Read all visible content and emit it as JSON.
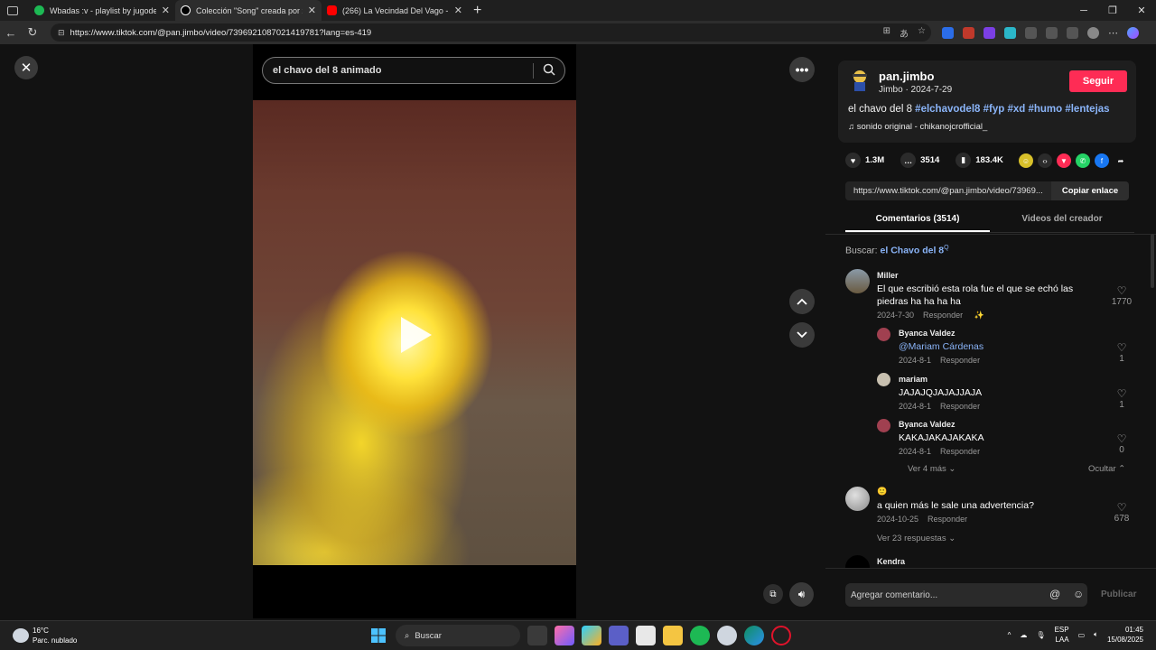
{
  "browser": {
    "tabs": [
      {
        "title": "Wbadas :v - playlist by jugodeuv",
        "color": "#1db954"
      },
      {
        "title": "Colección \"Song\" creada por xjun",
        "color": "#000000",
        "active": true
      },
      {
        "title": "(266) La Vecindad Del Vago - Chi",
        "color": "#ff0000"
      }
    ],
    "url": "https://www.tiktok.com/@pan.jimbo/video/7396921087021419781?lang=es-419"
  },
  "video": {
    "search_text": "el chavo del 8 animado"
  },
  "author": {
    "name": "pan.jimbo",
    "subtitle": "Jimbo · 2024-7-29",
    "follow_label": "Seguir",
    "desc_plain": "el chavo del 8",
    "hashtags": "#elchavodel8 #fyp #xd #humo #lentejas",
    "sound": "sonido original - chikanojcrofficial_"
  },
  "stats": {
    "likes": "1.3M",
    "comments": "3514",
    "saves": "183.4K"
  },
  "link": {
    "url": "https://www.tiktok.com/@pan.jimbo/video/73969...",
    "copy_label": "Copiar enlace"
  },
  "tabs": {
    "comments": "Comentarios (3514)",
    "creator_videos": "Videos del creador"
  },
  "buscar": {
    "label": "Buscar:",
    "term": "el Chavo del 8"
  },
  "comments": [
    {
      "name": "Miller",
      "text": "El que escribió esta rola fue el que se echó las piedras ha ha ha ha",
      "date": "2024-7-30",
      "reply": "Responder",
      "likes": "1770"
    },
    {
      "name": "Byanca Valdez",
      "text": "@Mariam Cárdenas",
      "date": "2024-8-1",
      "reply": "Responder",
      "likes": "1"
    },
    {
      "name": "mariam",
      "text": "JAJAJQJAJAJJAJA",
      "date": "2024-8-1",
      "reply": "Responder",
      "likes": "1"
    },
    {
      "name": "Byanca Valdez",
      "text": "KAKAJAKAJAKAKA",
      "date": "2024-8-1",
      "reply": "Responder",
      "likes": "0"
    },
    {
      "name": "",
      "text": "a quien más le sale una advertencia?",
      "date": "2024-10-25",
      "reply": "Responder",
      "likes": "678"
    },
    {
      "name": "Kendra",
      "text": "",
      "date": "",
      "reply": "",
      "likes": ""
    }
  ],
  "thread": {
    "more": "Ver 4 más",
    "hide": "Ocultar",
    "replies": "Ver 23 respuestas"
  },
  "composer": {
    "placeholder": "Agregar comentario...",
    "post_label": "Publicar"
  },
  "taskbar": {
    "temp": "16°C",
    "weather": "Parc. nublado",
    "search": "Buscar",
    "lang": "ESP",
    "lang2": "LAA",
    "time": "01:45",
    "date": "15/08/2025"
  },
  "colors": {
    "accent": "#fe2c55",
    "hashtag": "#8ab4f8"
  }
}
